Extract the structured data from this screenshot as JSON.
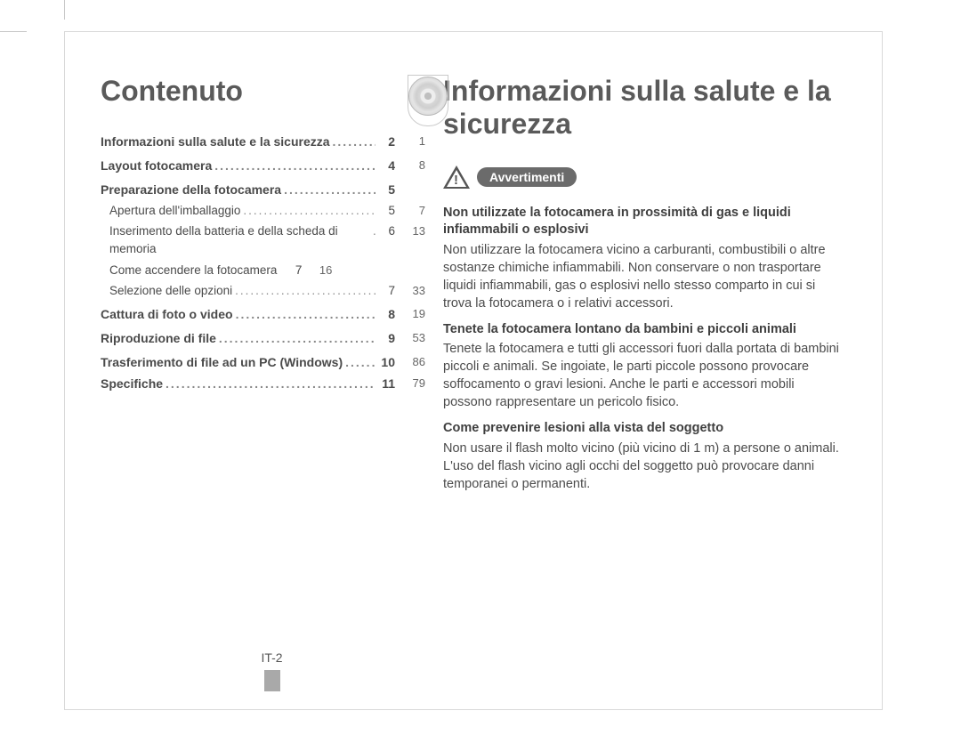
{
  "left": {
    "title": "Contenuto",
    "toc": [
      {
        "label": "Informazioni sulla salute e la sicurezza",
        "page": "2",
        "rand": "1",
        "bold": true,
        "sub": false,
        "showDots": true,
        "showRand": true
      },
      {
        "label": "Layout fotocamera",
        "page": "4",
        "rand": "8",
        "bold": true,
        "sub": false,
        "showDots": true,
        "showRand": true
      },
      {
        "label": "Preparazione della fotocamera",
        "page": "5",
        "rand": "",
        "bold": true,
        "sub": false,
        "showDots": true,
        "showRand": false
      },
      {
        "label": "Apertura dell'imballaggio",
        "page": "5",
        "rand": "7",
        "bold": false,
        "sub": true,
        "showDots": true,
        "showRand": true
      },
      {
        "label": "Inserimento della batteria e della scheda di memoria",
        "page": "6",
        "rand": "13",
        "bold": false,
        "sub": true,
        "showDots": true,
        "showRand": true
      },
      {
        "label": "Come accendere la fotocamera",
        "page": "7",
        "rand": "16",
        "bold": false,
        "sub": true,
        "showDots": false,
        "showRand": true
      },
      {
        "label": "Selezione delle opzioni",
        "page": "7",
        "rand": "33",
        "bold": false,
        "sub": true,
        "showDots": true,
        "showRand": true
      },
      {
        "label": "Cattura di foto o video",
        "page": "8",
        "rand": "19",
        "bold": true,
        "sub": false,
        "showDots": true,
        "showRand": true
      },
      {
        "label": "Riproduzione di file",
        "page": "9",
        "rand": "53",
        "bold": true,
        "sub": false,
        "showDots": true,
        "showRand": true
      },
      {
        "label": "Trasferimento di file ad un PC (Windows)",
        "page": "10",
        "rand": "86",
        "bold": true,
        "sub": false,
        "showDots": true,
        "showRand": true
      },
      {
        "label": "Specifiche",
        "page": "11",
        "rand": "79",
        "bold": true,
        "sub": false,
        "showDots": true,
        "showRand": true
      }
    ],
    "footer": "IT-2"
  },
  "right": {
    "title": "Informazioni sulla salute e la sicurezza",
    "badge": "Avvertimenti",
    "sections": [
      {
        "head": "Non utilizzate la fotocamera in prossimità di gas e liquidi infiammabili o esplosivi",
        "body": "Non utilizzare la fotocamera vicino a carburanti, combustibili o altre sostanze chimiche infiammabili. Non conservare o non trasportare liquidi infiammabili, gas o esplosivi nello stesso comparto in cui si trova la fotocamera o i relativi accessori."
      },
      {
        "head": "Tenete la fotocamera lontano da bambini e piccoli animali",
        "body": "Tenete la fotocamera e tutti gli accessori fuori dalla portata di bambini piccoli e animali. Se ingoiate, le parti piccole possono provocare soffocamento o gravi lesioni. Anche le parti e accessori mobili possono rappresentare un pericolo fisico."
      },
      {
        "head": "Come prevenire lesioni alla vista del soggetto",
        "body": "Non usare il flash molto vicino (più vicino di 1 m) a persone o animali. L'uso del flash vicino agli occhi del soggetto può provocare danni temporanei o permanenti."
      }
    ]
  }
}
